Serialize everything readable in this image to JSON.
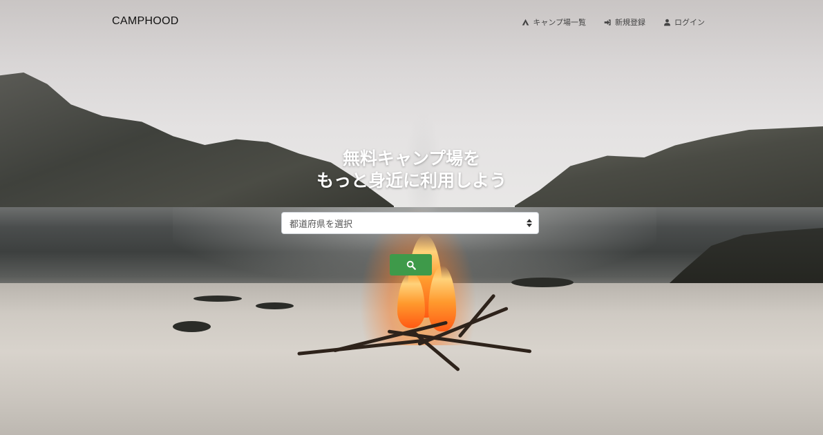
{
  "navbar": {
    "brand": "CAMPHOOD",
    "links": [
      {
        "label": "キャンプ場一覧",
        "icon": "campground-icon"
      },
      {
        "label": "新規登録",
        "icon": "sign-in-icon"
      },
      {
        "label": "ログイン",
        "icon": "user-icon"
      }
    ]
  },
  "hero": {
    "headline_line1": "無料キャンプ場を",
    "headline_line2": "もっと身近に利用しよう",
    "prefecture_select": {
      "value": "都道府県を選択"
    },
    "search_button": {
      "icon": "search-icon"
    }
  },
  "colors": {
    "search_button": "#3e9a4a",
    "brand_text": "#111111",
    "nav_text": "#444444"
  }
}
